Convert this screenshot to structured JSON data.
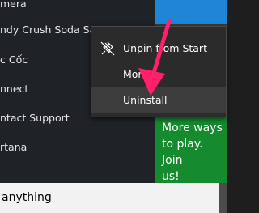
{
  "app_list": {
    "items": [
      {
        "label": "mera"
      },
      {
        "label": "ndy Crush Soda Saga"
      },
      {
        "label": "c Cốc"
      },
      {
        "label": "nnect"
      },
      {
        "label": "ntact Support"
      },
      {
        "label": "rtana"
      }
    ]
  },
  "tiles": {
    "promo_text": "More ways\nto play. Join\nus!",
    "colors": {
      "blue": "#1f86d7",
      "green": "#168a2f"
    }
  },
  "context_menu": {
    "items": [
      {
        "label": "Unpin from Start",
        "icon": "unpin-icon"
      },
      {
        "label": "More"
      },
      {
        "label": "Uninstall"
      }
    ]
  },
  "search": {
    "value": "anything"
  },
  "annotation": {
    "arrow_color": "#ff1f6a"
  }
}
